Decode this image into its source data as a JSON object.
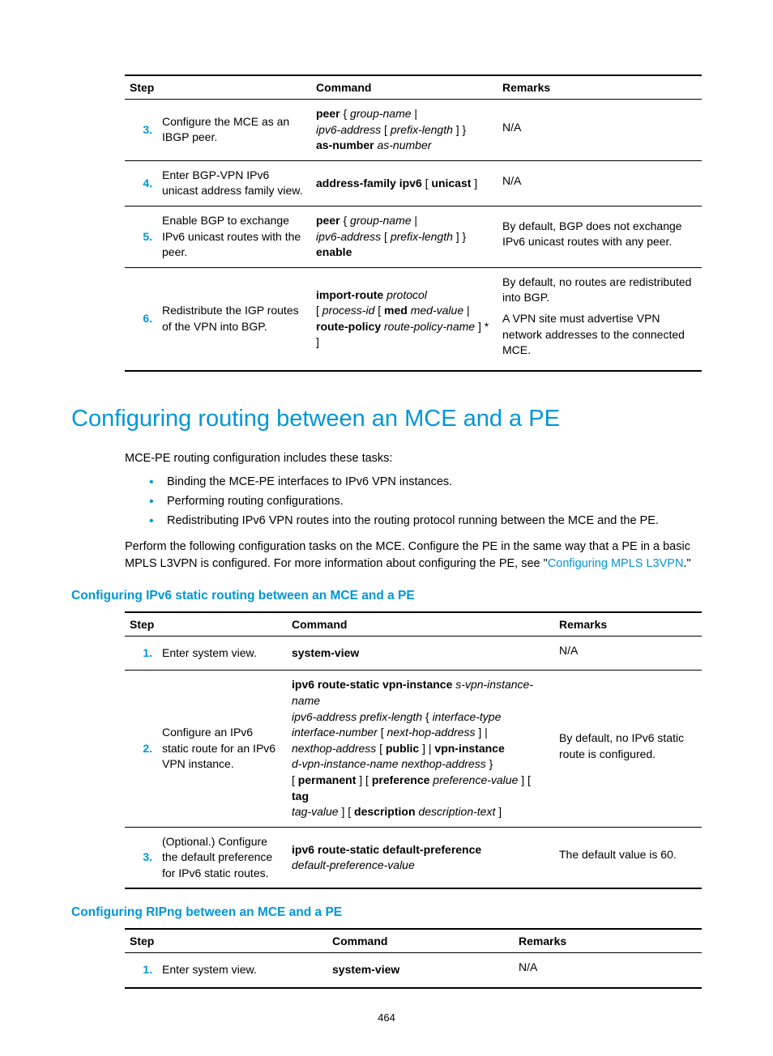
{
  "table1": {
    "head": {
      "step": "Step",
      "command": "Command",
      "remarks": "Remarks"
    },
    "rows": [
      {
        "num": "3.",
        "desc": "Configure the MCE as an IBGP peer.",
        "cmd": [
          {
            "b": "peer",
            "t": " { "
          },
          {
            "i": "group-name",
            "t": " | "
          },
          {
            "br": true
          },
          {
            "i": "ipv6-address",
            "t": " [ "
          },
          {
            "i": "prefix-length",
            "t": " ] } "
          },
          {
            "br": true
          },
          {
            "b": "as-number",
            "t": " "
          },
          {
            "i": "as-number"
          }
        ],
        "remarks": [
          "N/A"
        ]
      },
      {
        "num": "4.",
        "desc": "Enter BGP-VPN IPv6 unicast address family view.",
        "cmd": [
          {
            "b": "address-family ipv6",
            "t": " [ "
          },
          {
            "b": "unicast",
            "t": " ]"
          }
        ],
        "remarks": [
          "N/A"
        ]
      },
      {
        "num": "5.",
        "desc": "Enable BGP to exchange IPv6 unicast routes with the peer.",
        "cmd": [
          {
            "b": "peer",
            "t": " { "
          },
          {
            "i": "group-name",
            "t": " | "
          },
          {
            "br": true
          },
          {
            "i": "ipv6-address",
            "t": " [ "
          },
          {
            "i": "prefix-length",
            "t": " ] } "
          },
          {
            "br": true
          },
          {
            "b": "enable"
          }
        ],
        "remarks": [
          "By default, BGP does not exchange IPv6 unicast routes with any peer."
        ]
      },
      {
        "num": "6.",
        "desc": "Redistribute the IGP routes of the VPN into BGP.",
        "cmd": [
          {
            "b": "import-route",
            "t": " "
          },
          {
            "i": "protocol"
          },
          {
            "br": true
          },
          {
            "t": "[ "
          },
          {
            "i": "process-id",
            "t": " [ "
          },
          {
            "b": "med",
            "t": " "
          },
          {
            "i": "med-value",
            "t": " | "
          },
          {
            "br": true
          },
          {
            "b": "route-policy",
            "t": " "
          },
          {
            "i": "route-policy-name",
            "t": " ] * ]"
          }
        ],
        "remarks": [
          "By default, no routes are redistributed into BGP.",
          "A VPN site must advertise VPN network addresses to the connected MCE."
        ]
      }
    ]
  },
  "section_title": "Configuring routing between an MCE and a PE",
  "intro_line": "MCE-PE routing configuration includes these tasks:",
  "bullets": [
    "Binding the MCE-PE interfaces to IPv6 VPN instances.",
    "Performing routing configurations.",
    "Redistributing IPv6 VPN routes into the routing protocol running between the MCE and the PE."
  ],
  "para2_a": "Perform the following configuration tasks on the MCE. Configure the PE in the same way that a PE in a basic MPLS L3VPN is configured. For more information about configuring the PE, see \"",
  "para2_link": "Configuring MPLS L3VPN",
  "para2_b": ".\"",
  "sub1": "Configuring IPv6 static routing between an MCE and a PE",
  "table2": {
    "head": {
      "step": "Step",
      "command": "Command",
      "remarks": "Remarks"
    },
    "rows": [
      {
        "num": "1.",
        "desc": "Enter system view.",
        "cmd": [
          {
            "b": "system-view"
          }
        ],
        "remarks": [
          "N/A"
        ]
      },
      {
        "num": "2.",
        "desc": "Configure an IPv6 static route for an IPv6 VPN instance.",
        "cmd": [
          {
            "b": "ipv6 route-static vpn-instance",
            "t": " "
          },
          {
            "i": "s-vpn-instance-name"
          },
          {
            "br": true
          },
          {
            "i": "ipv6-address prefix-length",
            "t": " { "
          },
          {
            "i": "interface-type"
          },
          {
            "br": true
          },
          {
            "i": "interface-number",
            "t": " [ "
          },
          {
            "i": "next-hop-address",
            "t": " ] | "
          },
          {
            "br": true
          },
          {
            "i": "nexthop-address",
            "t": " [ "
          },
          {
            "b": "public",
            "t": " ] | "
          },
          {
            "b": "vpn-instance"
          },
          {
            "br": true
          },
          {
            "i": "d-vpn-instance-name nexthop-address",
            "t": " } "
          },
          {
            "br": true
          },
          {
            "t": "[ "
          },
          {
            "b": "permanent",
            "t": " ] [ "
          },
          {
            "b": "preference",
            "t": " "
          },
          {
            "i": "preference-value",
            "t": " ] [ "
          },
          {
            "b": "tag"
          },
          {
            "br": true
          },
          {
            "i": "tag-value",
            "t": " ] [ "
          },
          {
            "b": "description",
            "t": " "
          },
          {
            "i": "description-text",
            "t": " ]"
          }
        ],
        "remarks": [
          "By default, no IPv6 static route is configured."
        ]
      },
      {
        "num": "3.",
        "desc": "(Optional.) Configure the default preference for IPv6 static routes.",
        "cmd": [
          {
            "b": "ipv6 route-static default-preference"
          },
          {
            "br": true
          },
          {
            "i": "default-preference-value"
          }
        ],
        "remarks": [
          "The default value is 60."
        ]
      }
    ]
  },
  "sub2": "Configuring RIPng between an MCE and a PE",
  "table3": {
    "head": {
      "step": "Step",
      "command": "Command",
      "remarks": "Remarks"
    },
    "rows": [
      {
        "num": "1.",
        "desc": "Enter system view.",
        "cmd": [
          {
            "b": "system-view"
          }
        ],
        "remarks": [
          "N/A"
        ]
      }
    ]
  },
  "page_number": "464"
}
